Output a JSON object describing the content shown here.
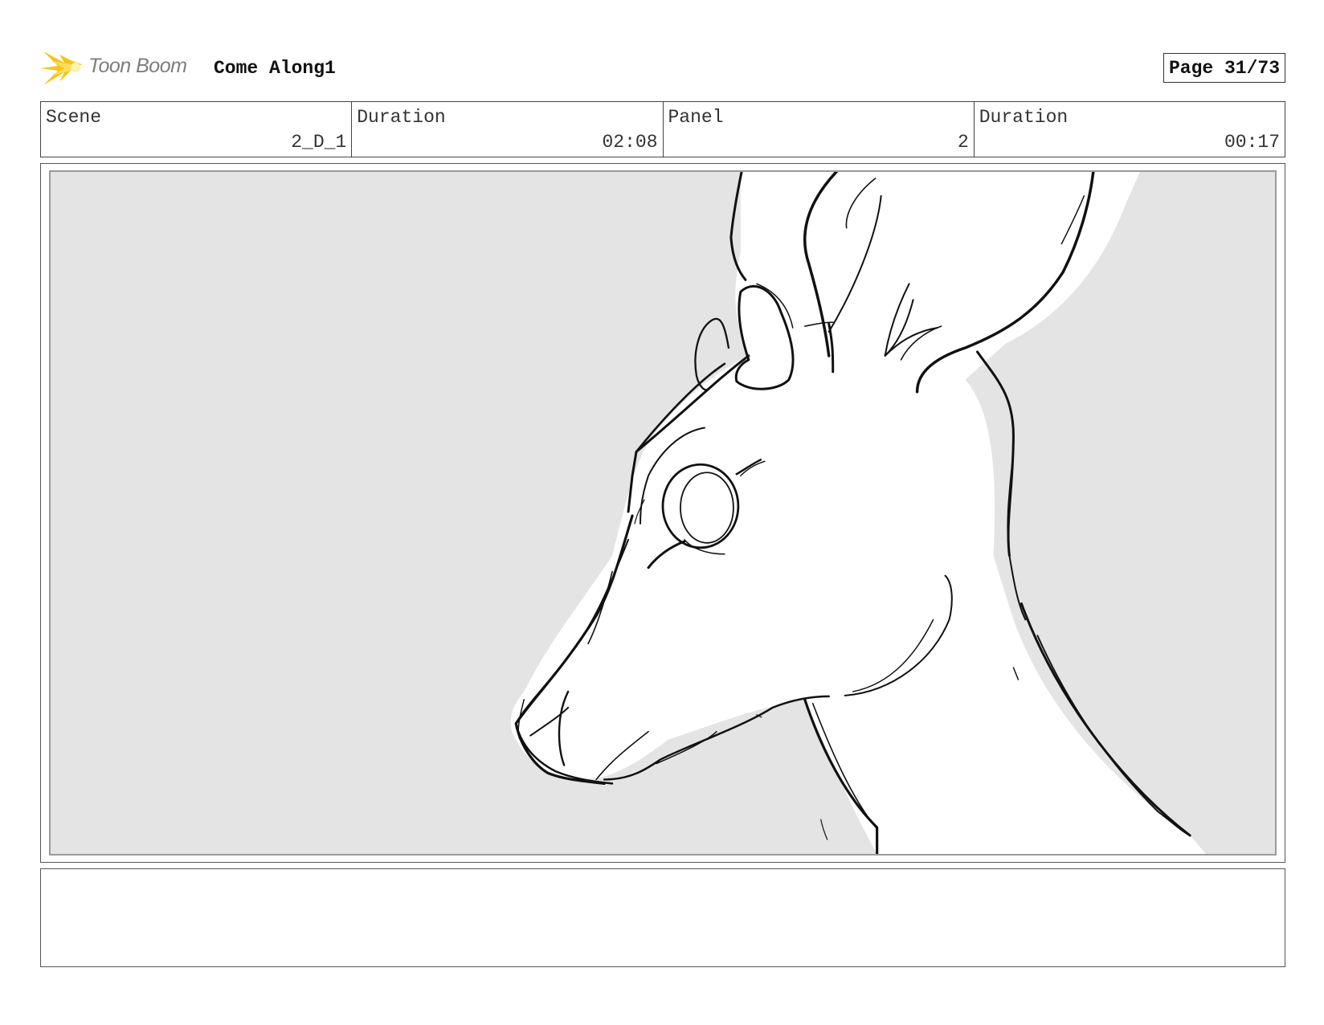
{
  "header": {
    "logo_text": "Toon Boom",
    "project_title": "Come Along1",
    "page_label": "Page 31/73"
  },
  "info": {
    "scene_label": "Scene",
    "scene_value": "2_D_1",
    "scene_duration_label": "Duration",
    "scene_duration_value": "02:08",
    "panel_label": "Panel",
    "panel_value": "2",
    "panel_duration_label": "Duration",
    "panel_duration_value": "00:17"
  },
  "colors": {
    "logo_accent": "#f5c518",
    "panel_background": "#e4e4e4",
    "sketch_line": "#111111"
  },
  "icons": {
    "logo": "toon-boom-burst-icon"
  }
}
